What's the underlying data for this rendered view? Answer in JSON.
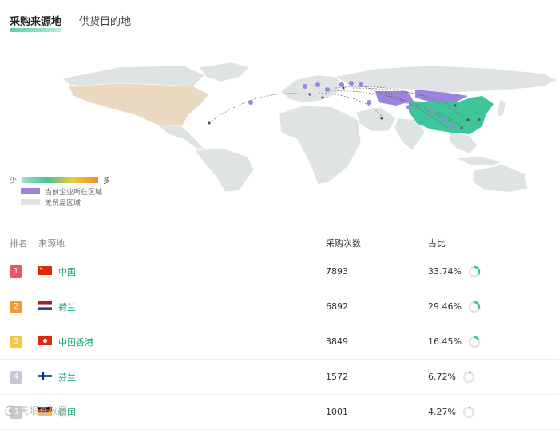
{
  "tabs": [
    {
      "label": "采购来源地",
      "active": true
    },
    {
      "label": "供货目的地",
      "active": false
    }
  ],
  "legend": {
    "low": "少",
    "high": "多",
    "region_label": "当前企业所在区域",
    "no_trade_label": "无贸易区域"
  },
  "colors": {
    "accent": "#3ec59a",
    "region": "#9b83e0",
    "no_trade": "#dfe3e3",
    "link": "#1aa57e",
    "routes": "#6f6f6f"
  },
  "table": {
    "headers": {
      "rank": "排名",
      "source": "来源地",
      "count": "采购次数",
      "share": "占比"
    },
    "rows": [
      {
        "rank": "1",
        "badge_color": "#f0506e",
        "flag": "cn-flag-icon",
        "name": "中国",
        "count": "7893",
        "share": "33.74%",
        "share_value": 33.74
      },
      {
        "rank": "2",
        "badge_color": "#f49a2e",
        "flag": "nl-flag-icon",
        "name": "荷兰",
        "count": "6892",
        "share": "29.46%",
        "share_value": 29.46
      },
      {
        "rank": "3",
        "badge_color": "#f5c842",
        "flag": "hk-flag-icon",
        "name": "中国香港",
        "count": "3849",
        "share": "16.45%",
        "share_value": 16.45
      },
      {
        "rank": "4",
        "badge_color": "#c3cad3",
        "flag": "fi-flag-icon",
        "name": "芬兰",
        "count": "1572",
        "share": "6.72%",
        "share_value": 6.72
      },
      {
        "rank": "5",
        "badge_color": "#c3cad3",
        "flag": "de-flag-icon",
        "name": "德国",
        "count": "1001",
        "share": "4.27%",
        "share_value": 4.27
      }
    ]
  },
  "watermark": "天眼查数据"
}
